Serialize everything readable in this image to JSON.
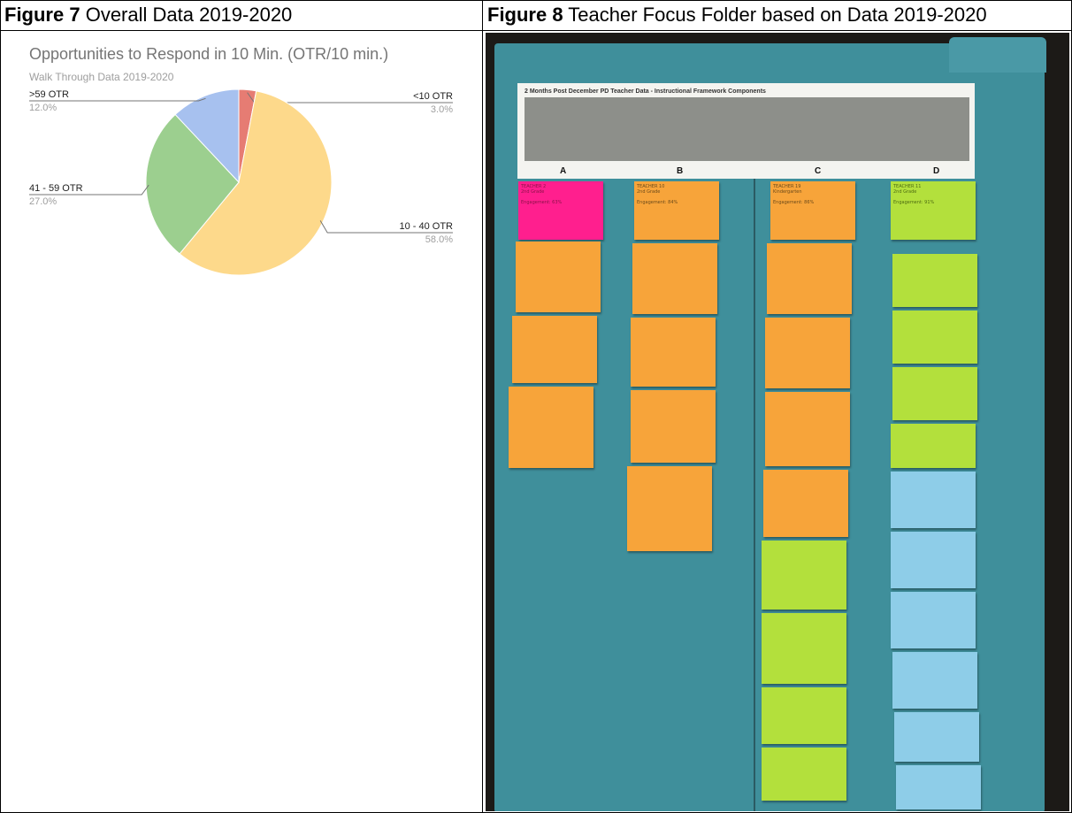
{
  "figures": {
    "fig7_label": "Figure 7",
    "fig7_title": "Overall Data 2019-2020",
    "fig8_label": "Figure 8",
    "fig8_title": "Teacher Focus Folder based on Data 2019-2020"
  },
  "chart_data": {
    "type": "pie",
    "title": "Opportunities to Respond in 10 Min. (OTR/10 min.)",
    "subtitle": "Walk Through Data 2019-2020",
    "slices": [
      {
        "label": "<10 OTR",
        "value": 3.0,
        "percent_label": "3.0%",
        "color": "#e67c73"
      },
      {
        "label": "10 - 40 OTR",
        "value": 58.0,
        "percent_label": "58.0%",
        "color": "#fdd98b"
      },
      {
        "label": "41 - 59 OTR",
        "value": 27.0,
        "percent_label": "27.0%",
        "color": "#9ccf8f"
      },
      {
        "label": ">59 OTR",
        "value": 12.0,
        "percent_label": "12.0%",
        "color": "#a7c1ef"
      }
    ]
  },
  "photo": {
    "sheet_title": "2 Months Post December PD Teacher Data - Instructional Framework Components",
    "column_letters": [
      "A",
      "B",
      "C",
      "D"
    ],
    "sticky_texts": [
      "TEACHER 2",
      "TEACHER 10",
      "TEACHER 19",
      "TEACHER 11",
      "2nd Grade",
      "2nd Grade",
      "Kindergarten",
      "2nd Grade",
      "Engagement: 63%",
      "Engagement: 84%",
      "Engagement: 86%",
      "Engagement: 91%"
    ]
  }
}
